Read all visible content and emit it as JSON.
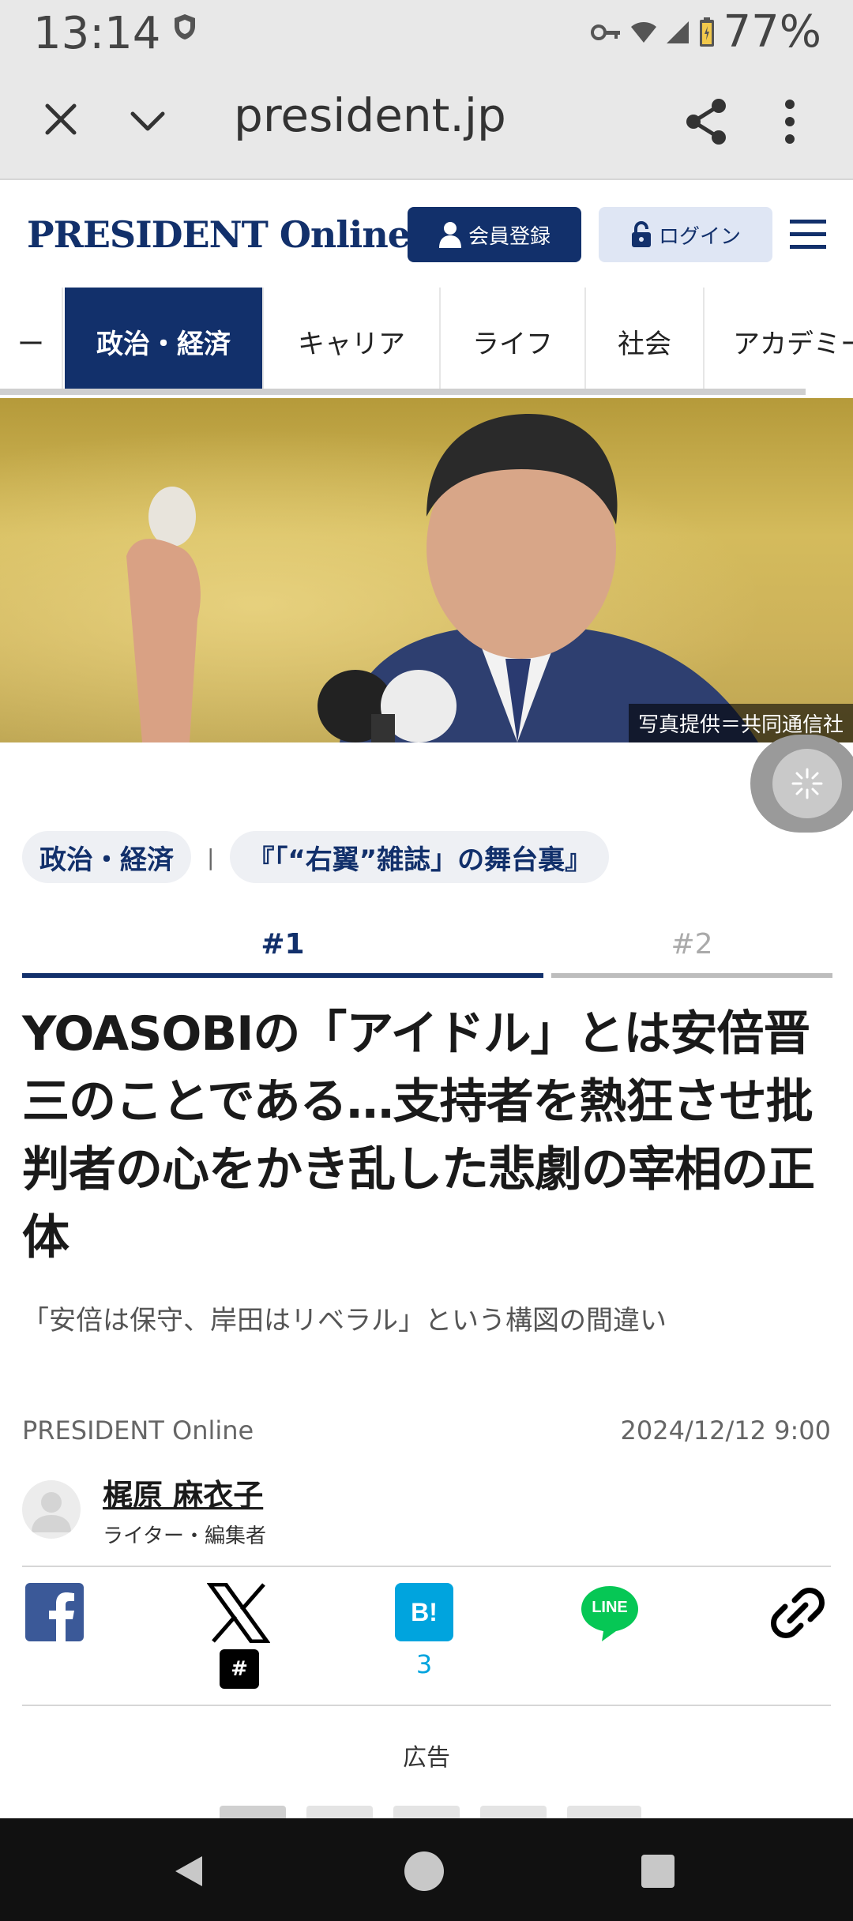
{
  "status_bar": {
    "time": "13:14",
    "battery_percent": "77%",
    "icons": [
      "shield-icon",
      "vpn-key-icon",
      "wifi-icon",
      "signal-icon",
      "battery-icon"
    ]
  },
  "browser": {
    "url": "president.jp",
    "icons": [
      "close-icon",
      "chevron-down-icon",
      "share-icon",
      "more-vert-icon"
    ]
  },
  "site": {
    "logo": "PRESIDENT Online",
    "register_label": "会員登録",
    "login_label": "ログイン",
    "brand_color": "#12306b"
  },
  "categories": {
    "items": [
      {
        "label": "ー"
      },
      {
        "label": "政治・経済",
        "active": true
      },
      {
        "label": "キャリア"
      },
      {
        "label": "ライフ"
      },
      {
        "label": "社会"
      },
      {
        "label": "アカデミー"
      }
    ]
  },
  "hero": {
    "photo_credit": "写真提供＝共同通信社"
  },
  "tags": {
    "category": "政治・経済",
    "separator": "|",
    "series": "『「“右翼”雑誌」の舞台裏』"
  },
  "parts": {
    "part1": "#1",
    "part2": "#2"
  },
  "article": {
    "title": "YOASOBIの「アイドル」とは安倍晋三のことである…支持者を熱狂させ批判者の心をかき乱した悲劇の宰相の正体",
    "subtitle": "「安倍は保守、岸田はリベラル」という構図の間違い",
    "source": "PRESIDENT Online",
    "date": "2024/12/12 9:00",
    "author_name": "梶原 麻衣子",
    "author_role": "ライター・編集者"
  },
  "share": {
    "x_hash": "#",
    "hatena_label": "B!",
    "hatena_count": "3",
    "line_label": "LINE"
  },
  "ad": {
    "label": "広告"
  }
}
